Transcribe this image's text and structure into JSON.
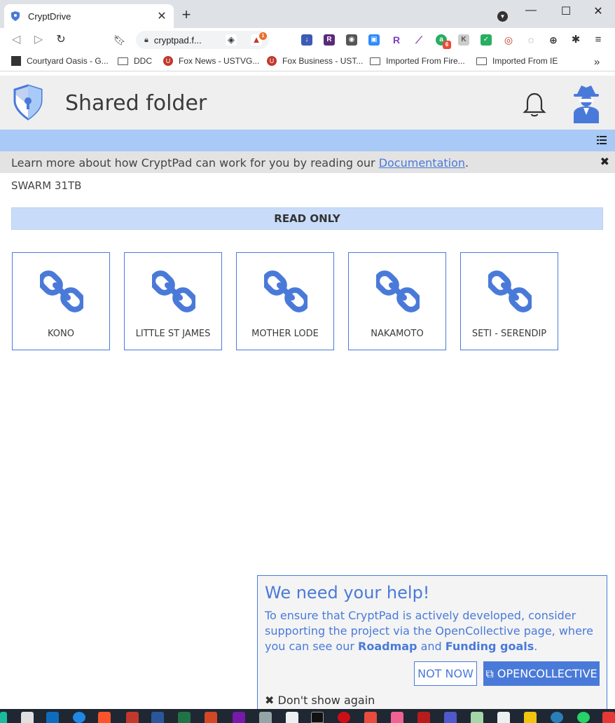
{
  "browser": {
    "tab_title": "CryptDrive",
    "tab_close": "✕",
    "new_tab": "+",
    "url": "cryptpad.f...",
    "brave_badge": "1",
    "ext_badge": "6",
    "window_controls": [
      "—",
      "☐",
      "✕"
    ]
  },
  "bookmarks": [
    "Courtyard Oasis - G...",
    "DDC",
    "Fox News - USTVG...",
    "Fox Business - UST...",
    "Imported From Fire...",
    "Imported From IE"
  ],
  "bookmarks_overflow": "»",
  "header": {
    "title": "Shared folder"
  },
  "info_banner": {
    "text": "Learn more about how CryptPad can work for you by reading our ",
    "link": "Documentation",
    "after": ".",
    "close": "✖"
  },
  "folder_path": "SWARM 31TB",
  "readonly_label": "READ ONLY",
  "items": [
    {
      "label": "KONO"
    },
    {
      "label": "LITTLE ST JAMES"
    },
    {
      "label": "MOTHER LODE"
    },
    {
      "label": "NAKAMOTO"
    },
    {
      "label": "SETI - SERENDIP"
    }
  ],
  "help": {
    "title": "We need your help!",
    "text_1": "To ensure that CryptPad is actively developed, consider supporting the project via the OpenCollective page, where you can see our ",
    "roadmap": "Roadmap",
    "and": " and ",
    "funding": "Funding goals",
    "period": ".",
    "not_now": "NOT NOW",
    "opencollective": "OPENCOLLECTIVE",
    "dont_show": "Don't show again"
  },
  "colors": {
    "accent": "#4a7ad9",
    "header_bg": "#efefef",
    "bar_bg": "#a9c9f7",
    "readonly_bg": "#c8dcf9"
  }
}
